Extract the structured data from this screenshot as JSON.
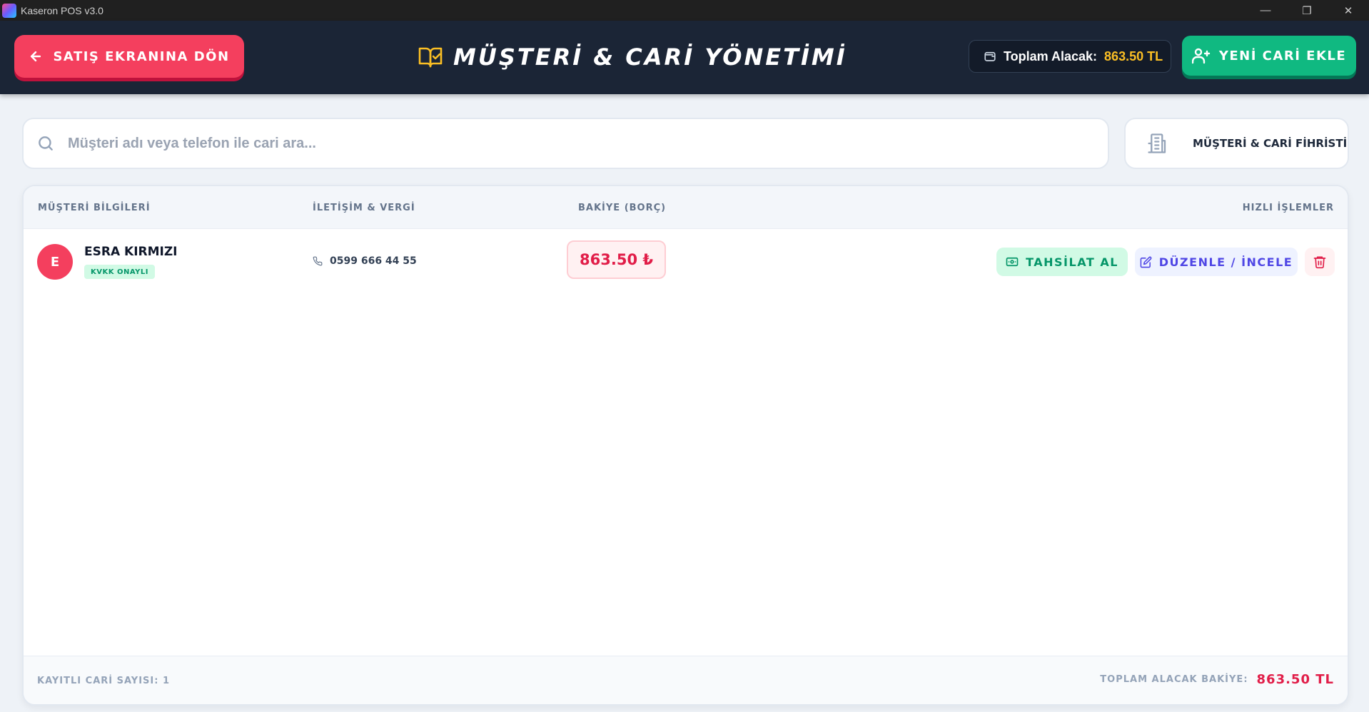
{
  "window": {
    "title": "Kaseron POS v3.0",
    "controls": {
      "minimize": "—",
      "restore": "❐",
      "close": "✕"
    }
  },
  "header": {
    "back_label": "SATIŞ EKRANINA DÖN",
    "title": "MÜŞTERİ & CARİ YÖNETİMİ",
    "total_label": "Toplam Alacak:",
    "total_value": "863.50 TL",
    "new_label": "YENİ CARİ EKLE"
  },
  "search": {
    "placeholder": "Müşteri adı veya telefon ile cari ara...",
    "value": ""
  },
  "directory_button": {
    "label": "MÜŞTERİ & CARİ FİHRİSTİ"
  },
  "table": {
    "columns": [
      "MÜŞTERİ BİLGİLERİ",
      "İLETİŞİM & VERGİ",
      "BAKİYE (BORÇ)",
      "HIZLI İŞLEMLER"
    ],
    "rows": [
      {
        "initial": "E",
        "name": "ESRA KIRMIZI",
        "badge": "KVKK ONAYLI",
        "phone": "0599 666 44 55",
        "balance": "863.50 ₺",
        "collect_label": "TAHSİLAT AL",
        "edit_label": "DÜZENLE / İNCELE"
      }
    ]
  },
  "footer": {
    "count_label": "KAYITLI CARİ SAYISI: 1",
    "total_label": "TOPLAM ALACAK BAKİYE:",
    "total_value": "863.50 TL"
  },
  "colors": {
    "header_bg": "#1b2536",
    "danger": "#f43f5e",
    "success": "#10b981",
    "accent_gold": "#fbbf24",
    "indigo": "#4f46e5"
  }
}
